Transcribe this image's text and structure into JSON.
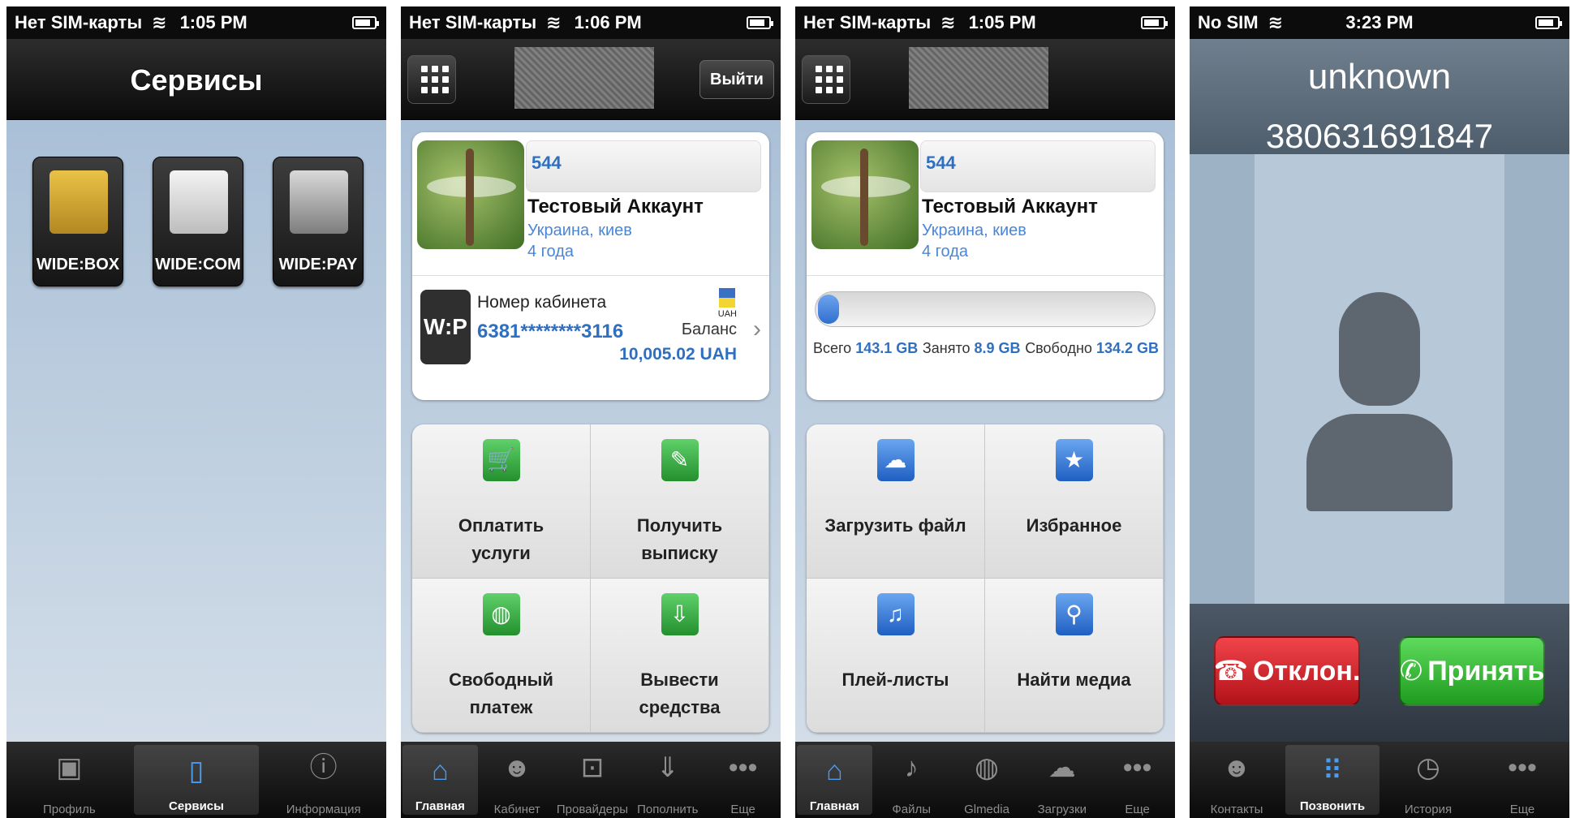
{
  "screen1": {
    "status": {
      "carrier": "Нет SIM-карты",
      "time": "1:05 PM"
    },
    "title": "Сервисы",
    "services": [
      {
        "label": "WIDE:BOX",
        "icon": "folder-sync-icon"
      },
      {
        "label": "WIDE:COM",
        "icon": "chat-icon"
      },
      {
        "label": "WIDE:PAY",
        "icon": "coins-icon"
      }
    ],
    "tabs": [
      {
        "label": "Профиль",
        "icon": "profile-icon"
      },
      {
        "label": "Сервисы",
        "icon": "phone-icon"
      },
      {
        "label": "Информация",
        "icon": "info-icon"
      }
    ],
    "active_tab": 1
  },
  "screen2": {
    "status": {
      "carrier": "Нет SIM-карты",
      "time": "1:06 PM"
    },
    "logout_label": "Выйти",
    "profile": {
      "id": "544",
      "name": "Тестовый Аккаунт",
      "location": "Украина, киев",
      "age": "4 года"
    },
    "cabinet": {
      "logo": "W:P",
      "label": "Номер кабинета",
      "number": "6381********3116",
      "currency": "UAH",
      "balance_label": "Баланс",
      "balance": "10,005.02 UAH"
    },
    "actions": [
      {
        "label_line1": "Оплатить",
        "label_line2": "услуги",
        "icon": "cart-icon"
      },
      {
        "label_line1": "Получить",
        "label_line2": "выписку",
        "icon": "document-icon"
      },
      {
        "label_line1": "Свободный",
        "label_line2": "платеж",
        "icon": "globe-icon"
      },
      {
        "label_line1": "Вывести",
        "label_line2": "средства",
        "icon": "withdraw-icon"
      }
    ],
    "tabs": [
      {
        "label": "Главная",
        "icon": "home-icon"
      },
      {
        "label": "Кабинет",
        "icon": "user-icon"
      },
      {
        "label": "Провайдеры",
        "icon": "cart-icon"
      },
      {
        "label": "Пополнить",
        "icon": "download-icon"
      },
      {
        "label": "Еще",
        "icon": "more-icon"
      }
    ],
    "active_tab": 0
  },
  "screen3": {
    "status": {
      "carrier": "Нет SIM-карты",
      "time": "1:05 PM"
    },
    "profile": {
      "id": "544",
      "name": "Тестовый Аккаунт",
      "location": "Украина, киев",
      "age": "4 года"
    },
    "storage": {
      "total_label": "Всего",
      "total": "143.1 GB",
      "used_label": "Занято",
      "used": "8.9 GB",
      "free_label": "Свободно",
      "free": "134.2 GB",
      "used_fraction": 0.062
    },
    "actions": [
      {
        "label": "Загрузить файл",
        "icon": "cloud-upload-icon"
      },
      {
        "label": "Избранное",
        "icon": "star-icon"
      },
      {
        "label": "Плей-листы",
        "icon": "playlist-icon"
      },
      {
        "label": "Найти медиа",
        "icon": "magnifier-icon"
      }
    ],
    "tabs": [
      {
        "label": "Главная",
        "icon": "home-icon"
      },
      {
        "label": "Файлы",
        "icon": "files-icon"
      },
      {
        "label": "Glmedia",
        "icon": "media-icon"
      },
      {
        "label": "Загрузки",
        "icon": "cloud-download-icon"
      },
      {
        "label": "Еще",
        "icon": "more-icon"
      }
    ],
    "active_tab": 0
  },
  "screen4": {
    "status": {
      "carrier": "No SIM",
      "time": "3:23 PM"
    },
    "caller_name": "unknown",
    "caller_number": "380631691847",
    "decline_label": "Отклон.",
    "accept_label": "Принять",
    "tabs": [
      {
        "label": "Контакты",
        "icon": "contacts-icon"
      },
      {
        "label": "Позвонить",
        "icon": "keypad-icon"
      },
      {
        "label": "История",
        "icon": "clock-icon"
      },
      {
        "label": "Еще",
        "icon": "more-icon"
      }
    ],
    "active_tab": 1
  },
  "colors": {
    "accent_blue": "#2f6fc0",
    "decline_red": "#d8262c",
    "accept_green": "#34b934"
  }
}
